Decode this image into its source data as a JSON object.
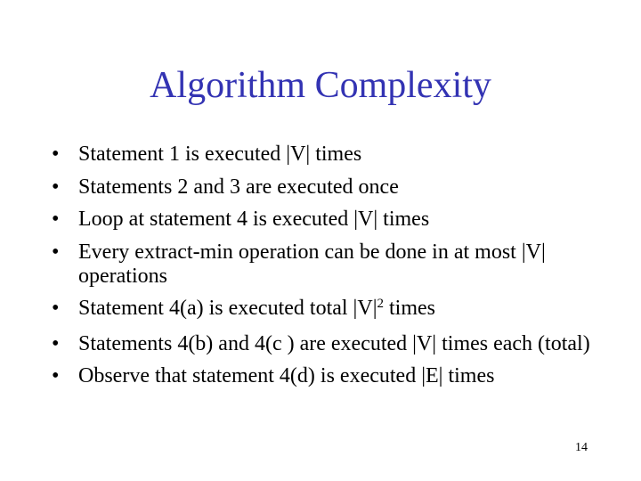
{
  "slide": {
    "title": "Algorithm Complexity",
    "title_color": "#3333b3",
    "bullet_glyph": "•",
    "bullets": [
      {
        "text": "Statement 1 is executed |V| times"
      },
      {
        "text": "Statements 2 and 3 are executed once"
      },
      {
        "text": "Loop at statement 4 is executed |V| times"
      },
      {
        "text": "Every extract-min operation can be done in at most |V| operations"
      },
      {
        "text_before": "Statement 4(a) is executed total |V|",
        "superscript": "2",
        "text_after": " times"
      },
      {
        "text": "Statements 4(b) and 4(c ) are executed |V| times each (total)"
      },
      {
        "text": "Observe that statement 4(d) is executed |E| times"
      }
    ],
    "page_number": "14"
  }
}
